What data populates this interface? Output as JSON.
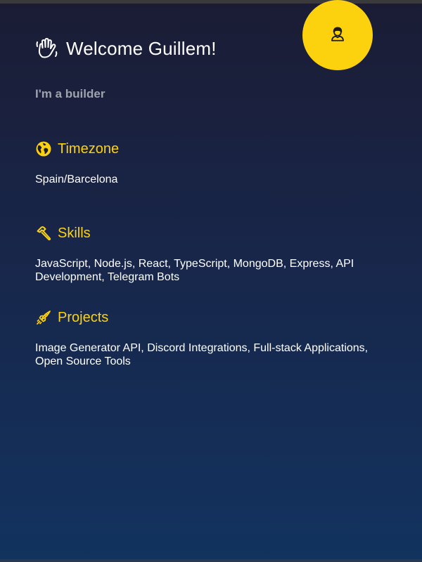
{
  "header": {
    "greeting": "Welcome Guillem!",
    "subtitle": "I'm a builder"
  },
  "icons": {
    "wave": "waving-hand-icon",
    "avatar": "person-icon",
    "timezone": "globe-icon",
    "skills": "hammer-icon",
    "projects": "rocket-icon"
  },
  "sections": {
    "timezone": {
      "title": "Timezone",
      "body": "Spain/Barcelona"
    },
    "skills": {
      "title": "Skills",
      "body": "JavaScript, Node.js, React, TypeScript, MongoDB, Express, API Development, Telegram Bots"
    },
    "projects": {
      "title": "Projects",
      "body": "Image Generator API, Discord Integrations, Full-stack Applications, Open Source Tools"
    }
  },
  "colors": {
    "accent": "#fcd20e",
    "text": "#ffffff",
    "muted": "#9ea3ad"
  }
}
